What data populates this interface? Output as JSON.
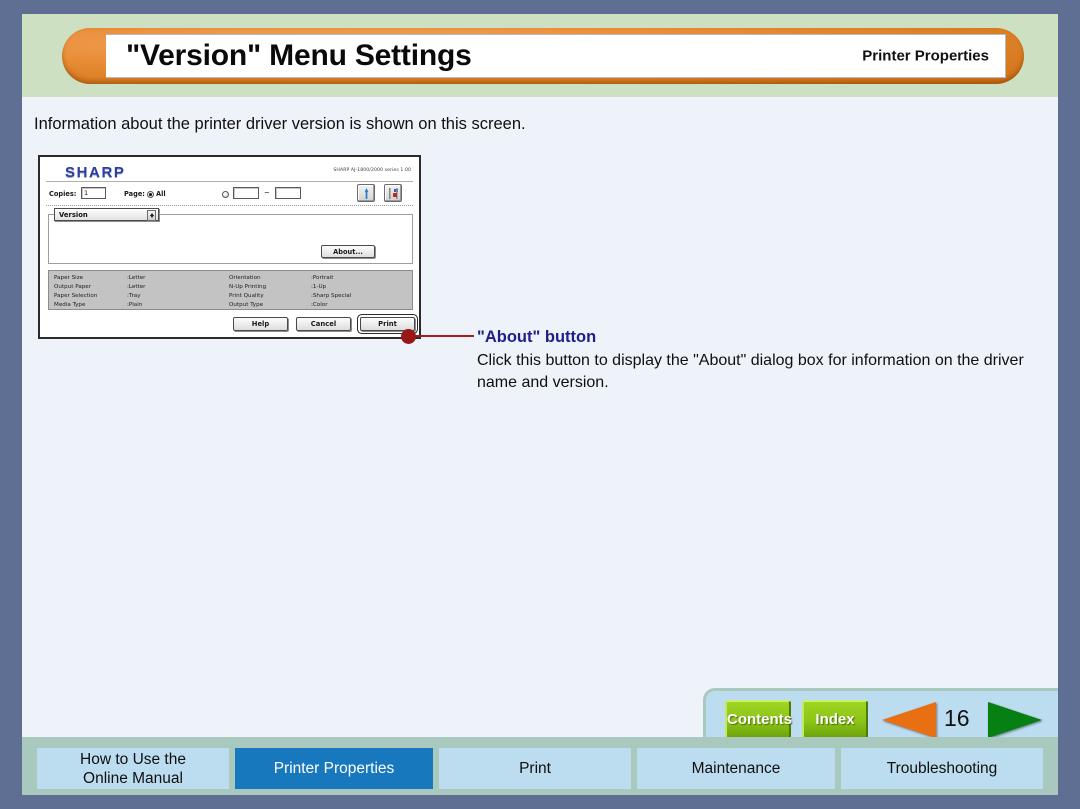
{
  "header": {
    "title": "\"Version\" Menu Settings",
    "badge": "Printer Properties"
  },
  "body": {
    "intro": "Information about the printer driver version is shown on this screen."
  },
  "dialog": {
    "logo": "SHARP",
    "driver_version": "SHARP AJ-1800/2000 series 1.00",
    "copies_label": "Copies:",
    "copies_value": "1",
    "page_label": "Page:",
    "page_all_label": "All",
    "range_separator": "~",
    "range_from": "",
    "range_to": "",
    "popup_value": "Version",
    "about_button": "About...",
    "summary": {
      "rows": [
        {
          "label": "Paper Size",
          "value": ":Letter",
          "label2": "Orientation",
          "value2": ":Portrait"
        },
        {
          "label": "Output Paper",
          "value": ":Letter",
          "label2": "N-Up Printing",
          "value2": ":1-Up"
        },
        {
          "label": "Paper Selection",
          "value": ":Tray",
          "label2": "Print Quality",
          "value2": ":Sharp Special"
        },
        {
          "label": "Media Type",
          "value": ":Plain",
          "label2": "Output Type",
          "value2": ":Color"
        }
      ]
    },
    "buttons": {
      "help": "Help",
      "cancel": "Cancel",
      "print": "Print"
    }
  },
  "callout": {
    "title": "\"About\" button",
    "body": "Click this button to display the \"About\" dialog box for information on the driver name and version."
  },
  "nav": {
    "contents": "Contents",
    "index": "Index",
    "page_number": "16",
    "prev_icon": "left-triangle-icon",
    "next_icon": "right-triangle-icon"
  },
  "footer": {
    "tabs": [
      {
        "label": "How to Use the\nOnline Manual",
        "active": false
      },
      {
        "label": "Printer Properties",
        "active": true
      },
      {
        "label": "Print",
        "active": false
      },
      {
        "label": "Maintenance",
        "active": false
      },
      {
        "label": "Troubleshooting",
        "active": false
      }
    ]
  },
  "colors": {
    "frame": "#5f6f93",
    "header_band": "#cde0c1",
    "title_orange": "#e88c35",
    "body_bg": "#eef2f9",
    "accent_blue": "#1878be",
    "tab_blue": "#bcdcf0",
    "footer_green": "#a9c9bf",
    "callout_red": "#9b1717",
    "callout_title_blue": "#1e1e8c",
    "nav_green": "#8cc518",
    "prev_orange": "#e87012",
    "next_green": "#068012"
  }
}
